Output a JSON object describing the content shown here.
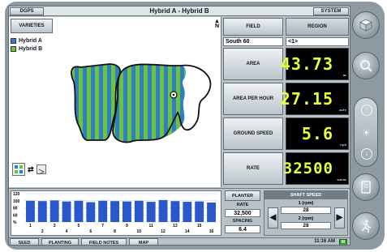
{
  "header": {
    "dgps_label": "DGPS",
    "title": "Hybrid A - Hybrid B",
    "system_label": "SYSTEM"
  },
  "map": {
    "varieties_label": "VARIETIES",
    "north_label": "N",
    "legend": [
      {
        "label": "Hybrid A",
        "color": "#2f7fc6"
      },
      {
        "label": "Hybrid B",
        "color": "#6dc43c"
      }
    ]
  },
  "tabs": {
    "field_label": "FIELD",
    "region_label": "REGION",
    "field_value": "South 60",
    "region_value": "<1>"
  },
  "metrics": [
    {
      "label": "AREA",
      "value": "43.73",
      "unit": "ac"
    },
    {
      "label": "AREA PER HOUR",
      "value": "27.15",
      "unit": "ac/hr"
    },
    {
      "label": "GROUND SPEED",
      "value": "5.6",
      "unit": "mph"
    },
    {
      "label": "RATE",
      "value": "32500",
      "unit": "sds/ac"
    }
  ],
  "row_chart": {
    "y_ticks": [
      "120",
      "100",
      "80",
      "60",
      "%"
    ],
    "odd_labels": [
      "1",
      "3",
      "5",
      "7",
      "9",
      "11",
      "13",
      "15"
    ],
    "even_labels": [
      "2",
      "4",
      "6",
      "8",
      "10",
      "12",
      "14",
      "16"
    ],
    "values": [
      100,
      99,
      101,
      98,
      100,
      96,
      100,
      99,
      98,
      100,
      97,
      102,
      99,
      97,
      98,
      95
    ]
  },
  "planter": {
    "planter_label": "PLANTER",
    "rate_label": "RATE",
    "rate_value": "32,500",
    "spacing_label": "SPACING",
    "spacing_value": "6.4"
  },
  "shaft_speed": {
    "title": "SHAFT SPEED",
    "shaft1_label": "1 (rpm)",
    "shaft1_value": "28",
    "shaft2_label": "2 (rpm)",
    "shaft2_value": "28",
    "left_arrow": "◀",
    "right_arrow": "▶"
  },
  "footer": {
    "seed_label": "SEED",
    "planting_label": "PLANTING",
    "field_notes_label": "FIELD NOTES",
    "map_label": "MAP",
    "time": "11:16 AM",
    "status_led": "M"
  },
  "colors": {
    "hybrid_a": "#2f7fc6",
    "hybrid_b": "#6dc43c",
    "bar": "#2a57c9",
    "display_text": "#e8ff3a"
  }
}
